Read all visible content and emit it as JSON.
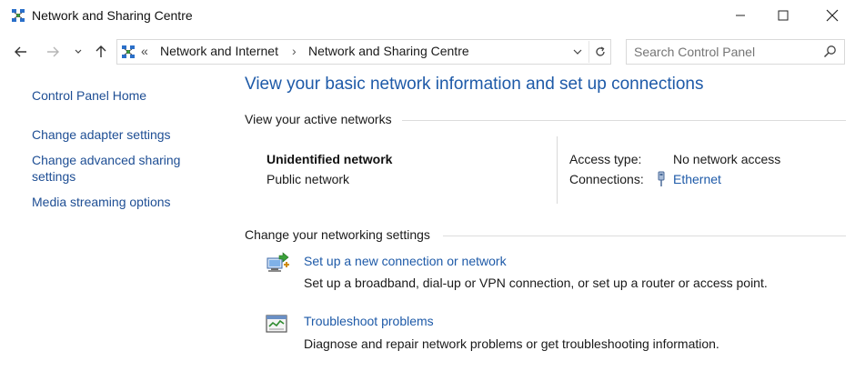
{
  "window": {
    "title": "Network and Sharing Centre"
  },
  "address": {
    "overflow": "«",
    "crumbs": [
      "Network and Internet",
      "Network and Sharing Centre"
    ],
    "separator": "›"
  },
  "search": {
    "placeholder": "Search Control Panel"
  },
  "sidebar": {
    "items": [
      {
        "label": "Control Panel Home"
      },
      {
        "label": "Change adapter settings"
      },
      {
        "label": "Change advanced sharing settings"
      },
      {
        "label": "Media streaming options"
      }
    ]
  },
  "main": {
    "title": "View your basic network information and set up connections",
    "active_networks_heading": "View your active networks",
    "network": {
      "name": "Unidentified network",
      "type": "Public network",
      "access_type_label": "Access type:",
      "access_type_value": "No network access",
      "connections_label": "Connections:",
      "connections_value": "Ethernet"
    },
    "settings_heading": "Change your networking settings",
    "tasks": [
      {
        "link": "Set up a new connection or network",
        "desc": "Set up a broadband, dial-up or VPN connection, or set up a router or access point.",
        "icon": "new-connection-icon"
      },
      {
        "link": "Troubleshoot problems",
        "desc": "Diagnose and repair network problems or get troubleshooting information.",
        "icon": "troubleshoot-icon"
      }
    ]
  },
  "colors": {
    "link": "#1e5aa8",
    "sidebar_link": "#1e4e94"
  }
}
